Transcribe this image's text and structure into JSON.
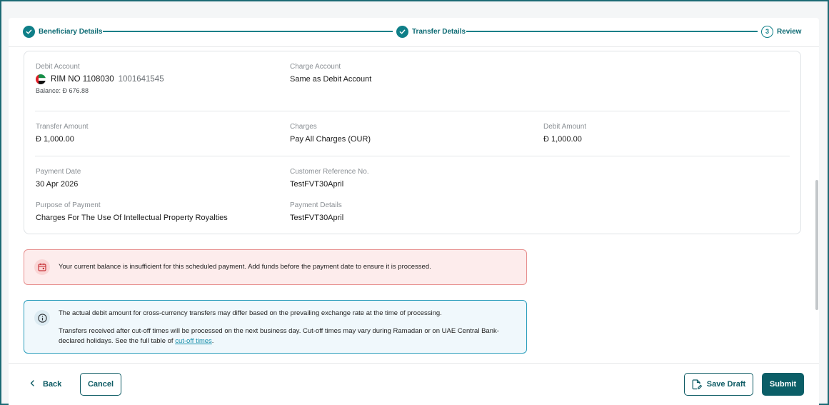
{
  "stepper": {
    "steps": [
      {
        "label": "Beneficiary Details",
        "status": "done"
      },
      {
        "label": "Transfer Details",
        "status": "done"
      },
      {
        "label": "Review",
        "status": "current",
        "number": "3"
      }
    ]
  },
  "debit": {
    "label": "Debit Account",
    "account_name": "RIM NO 1108030",
    "account_number": "1001641545",
    "balance": "Balance: Ð 676.88",
    "flag_icon": "uae-flag-icon"
  },
  "charge_account": {
    "label": "Charge Account",
    "value": "Same as Debit Account"
  },
  "transfer_amount": {
    "label": "Transfer Amount",
    "value": "Ð 1,000.00"
  },
  "charges": {
    "label": "Charges",
    "value": "Pay All Charges (OUR)"
  },
  "debit_amount": {
    "label": "Debit Amount",
    "value": "Ð 1,000.00"
  },
  "payment_date": {
    "label": "Payment Date",
    "value": "30 Apr 2026"
  },
  "customer_ref": {
    "label": "Customer Reference No.",
    "value": "TestFVT30April"
  },
  "purpose": {
    "label": "Purpose of Payment",
    "value": "Charges For The Use Of Intellectual Property Royalties"
  },
  "payment_details": {
    "label": "Payment Details",
    "value": "TestFVT30April"
  },
  "alerts": {
    "warning": "Your current balance is insufficient for this scheduled payment. Add funds before the payment date to ensure it is processed.",
    "info_line1": "The actual debit amount for cross-currency transfers may differ based on the prevailing exchange rate at the time of processing.",
    "info_line2_prefix": "Transfers received after cut-off times will be processed on the next business day. Cut-off times may vary during Ramadan or on UAE Central Bank-declared holidays. See the full table of ",
    "info_link": "cut-off times",
    "info_line2_suffix": "."
  },
  "footer": {
    "back": "Back",
    "cancel": "Cancel",
    "save_draft": "Save Draft",
    "submit": "Submit"
  },
  "colors": {
    "accent": "#0f7f88",
    "primary_button": "#0b5e67",
    "warning_bg": "#fdecec",
    "warning_border": "#e7908f",
    "info_bg": "#f0f8fc",
    "info_border": "#2e9fbd"
  }
}
